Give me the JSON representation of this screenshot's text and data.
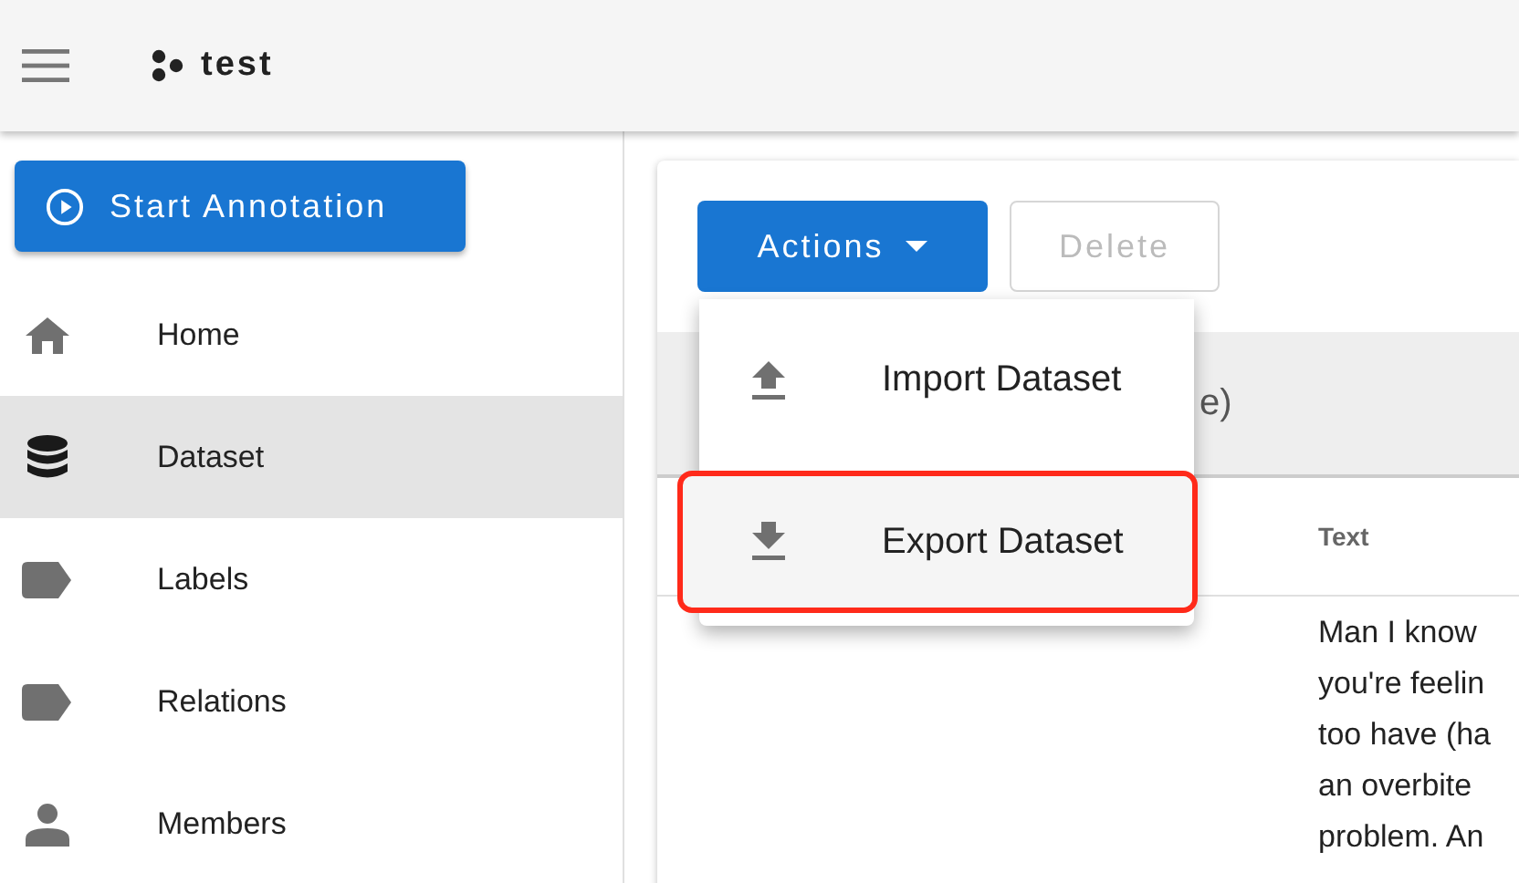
{
  "app_bar": {
    "title": "test"
  },
  "sidebar": {
    "start_button": "Start Annotation",
    "items": [
      {
        "label": "Home",
        "kind": "home",
        "selected": false
      },
      {
        "label": "Dataset",
        "kind": "database",
        "selected": true
      },
      {
        "label": "Labels",
        "kind": "label",
        "selected": false
      },
      {
        "label": "Relations",
        "kind": "label",
        "selected": false
      },
      {
        "label": "Members",
        "kind": "person",
        "selected": false
      }
    ]
  },
  "toolbar": {
    "actions_button": "Actions",
    "delete_button": {
      "label": "Delete",
      "disabled": true
    }
  },
  "menu": {
    "items": [
      {
        "label": "Import Dataset",
        "kind": "upload",
        "highlighted": false
      },
      {
        "label": "Export Dataset",
        "kind": "download",
        "highlighted": true
      }
    ]
  },
  "band_text": "e)",
  "table": {
    "columns": [
      "Text"
    ],
    "rows": [
      {
        "text_lines": [
          "Man I know",
          "you're feelin",
          "too have (ha",
          "an overbite",
          "problem. An"
        ]
      }
    ]
  }
}
